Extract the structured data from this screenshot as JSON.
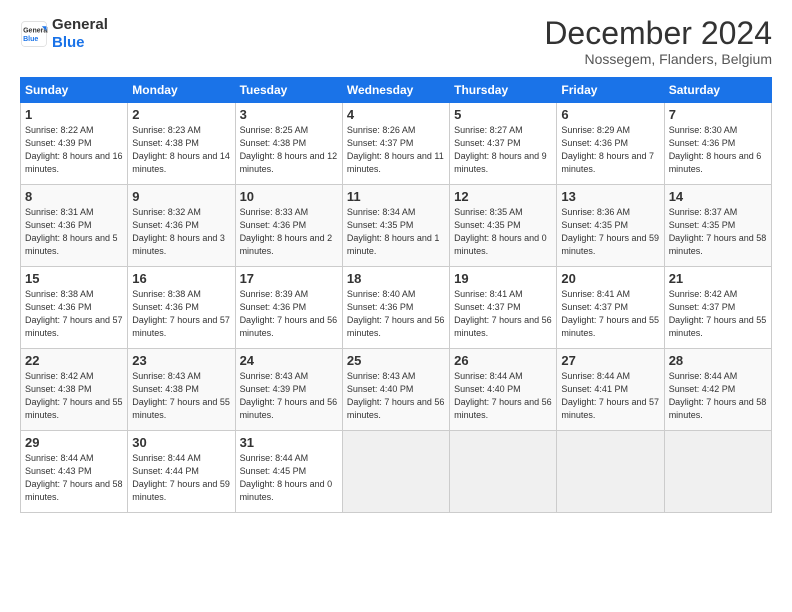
{
  "logo": {
    "line1": "General",
    "line2": "Blue"
  },
  "title": "December 2024",
  "subtitle": "Nossegem, Flanders, Belgium",
  "days_header": [
    "Sunday",
    "Monday",
    "Tuesday",
    "Wednesday",
    "Thursday",
    "Friday",
    "Saturday"
  ],
  "weeks": [
    [
      {
        "day": "1",
        "sunrise": "8:22 AM",
        "sunset": "4:39 PM",
        "daylight": "8 hours and 16 minutes."
      },
      {
        "day": "2",
        "sunrise": "8:23 AM",
        "sunset": "4:38 PM",
        "daylight": "8 hours and 14 minutes."
      },
      {
        "day": "3",
        "sunrise": "8:25 AM",
        "sunset": "4:38 PM",
        "daylight": "8 hours and 12 minutes."
      },
      {
        "day": "4",
        "sunrise": "8:26 AM",
        "sunset": "4:37 PM",
        "daylight": "8 hours and 11 minutes."
      },
      {
        "day": "5",
        "sunrise": "8:27 AM",
        "sunset": "4:37 PM",
        "daylight": "8 hours and 9 minutes."
      },
      {
        "day": "6",
        "sunrise": "8:29 AM",
        "sunset": "4:36 PM",
        "daylight": "8 hours and 7 minutes."
      },
      {
        "day": "7",
        "sunrise": "8:30 AM",
        "sunset": "4:36 PM",
        "daylight": "8 hours and 6 minutes."
      }
    ],
    [
      {
        "day": "8",
        "sunrise": "8:31 AM",
        "sunset": "4:36 PM",
        "daylight": "8 hours and 5 minutes."
      },
      {
        "day": "9",
        "sunrise": "8:32 AM",
        "sunset": "4:36 PM",
        "daylight": "8 hours and 3 minutes."
      },
      {
        "day": "10",
        "sunrise": "8:33 AM",
        "sunset": "4:36 PM",
        "daylight": "8 hours and 2 minutes."
      },
      {
        "day": "11",
        "sunrise": "8:34 AM",
        "sunset": "4:35 PM",
        "daylight": "8 hours and 1 minute."
      },
      {
        "day": "12",
        "sunrise": "8:35 AM",
        "sunset": "4:35 PM",
        "daylight": "8 hours and 0 minutes."
      },
      {
        "day": "13",
        "sunrise": "8:36 AM",
        "sunset": "4:35 PM",
        "daylight": "7 hours and 59 minutes."
      },
      {
        "day": "14",
        "sunrise": "8:37 AM",
        "sunset": "4:35 PM",
        "daylight": "7 hours and 58 minutes."
      }
    ],
    [
      {
        "day": "15",
        "sunrise": "8:38 AM",
        "sunset": "4:36 PM",
        "daylight": "7 hours and 57 minutes."
      },
      {
        "day": "16",
        "sunrise": "8:38 AM",
        "sunset": "4:36 PM",
        "daylight": "7 hours and 57 minutes."
      },
      {
        "day": "17",
        "sunrise": "8:39 AM",
        "sunset": "4:36 PM",
        "daylight": "7 hours and 56 minutes."
      },
      {
        "day": "18",
        "sunrise": "8:40 AM",
        "sunset": "4:36 PM",
        "daylight": "7 hours and 56 minutes."
      },
      {
        "day": "19",
        "sunrise": "8:41 AM",
        "sunset": "4:37 PM",
        "daylight": "7 hours and 56 minutes."
      },
      {
        "day": "20",
        "sunrise": "8:41 AM",
        "sunset": "4:37 PM",
        "daylight": "7 hours and 55 minutes."
      },
      {
        "day": "21",
        "sunrise": "8:42 AM",
        "sunset": "4:37 PM",
        "daylight": "7 hours and 55 minutes."
      }
    ],
    [
      {
        "day": "22",
        "sunrise": "8:42 AM",
        "sunset": "4:38 PM",
        "daylight": "7 hours and 55 minutes."
      },
      {
        "day": "23",
        "sunrise": "8:43 AM",
        "sunset": "4:38 PM",
        "daylight": "7 hours and 55 minutes."
      },
      {
        "day": "24",
        "sunrise": "8:43 AM",
        "sunset": "4:39 PM",
        "daylight": "7 hours and 56 minutes."
      },
      {
        "day": "25",
        "sunrise": "8:43 AM",
        "sunset": "4:40 PM",
        "daylight": "7 hours and 56 minutes."
      },
      {
        "day": "26",
        "sunrise": "8:44 AM",
        "sunset": "4:40 PM",
        "daylight": "7 hours and 56 minutes."
      },
      {
        "day": "27",
        "sunrise": "8:44 AM",
        "sunset": "4:41 PM",
        "daylight": "7 hours and 57 minutes."
      },
      {
        "day": "28",
        "sunrise": "8:44 AM",
        "sunset": "4:42 PM",
        "daylight": "7 hours and 58 minutes."
      }
    ],
    [
      {
        "day": "29",
        "sunrise": "8:44 AM",
        "sunset": "4:43 PM",
        "daylight": "7 hours and 58 minutes."
      },
      {
        "day": "30",
        "sunrise": "8:44 AM",
        "sunset": "4:44 PM",
        "daylight": "7 hours and 59 minutes."
      },
      {
        "day": "31",
        "sunrise": "8:44 AM",
        "sunset": "4:45 PM",
        "daylight": "8 hours and 0 minutes."
      },
      null,
      null,
      null,
      null
    ]
  ]
}
